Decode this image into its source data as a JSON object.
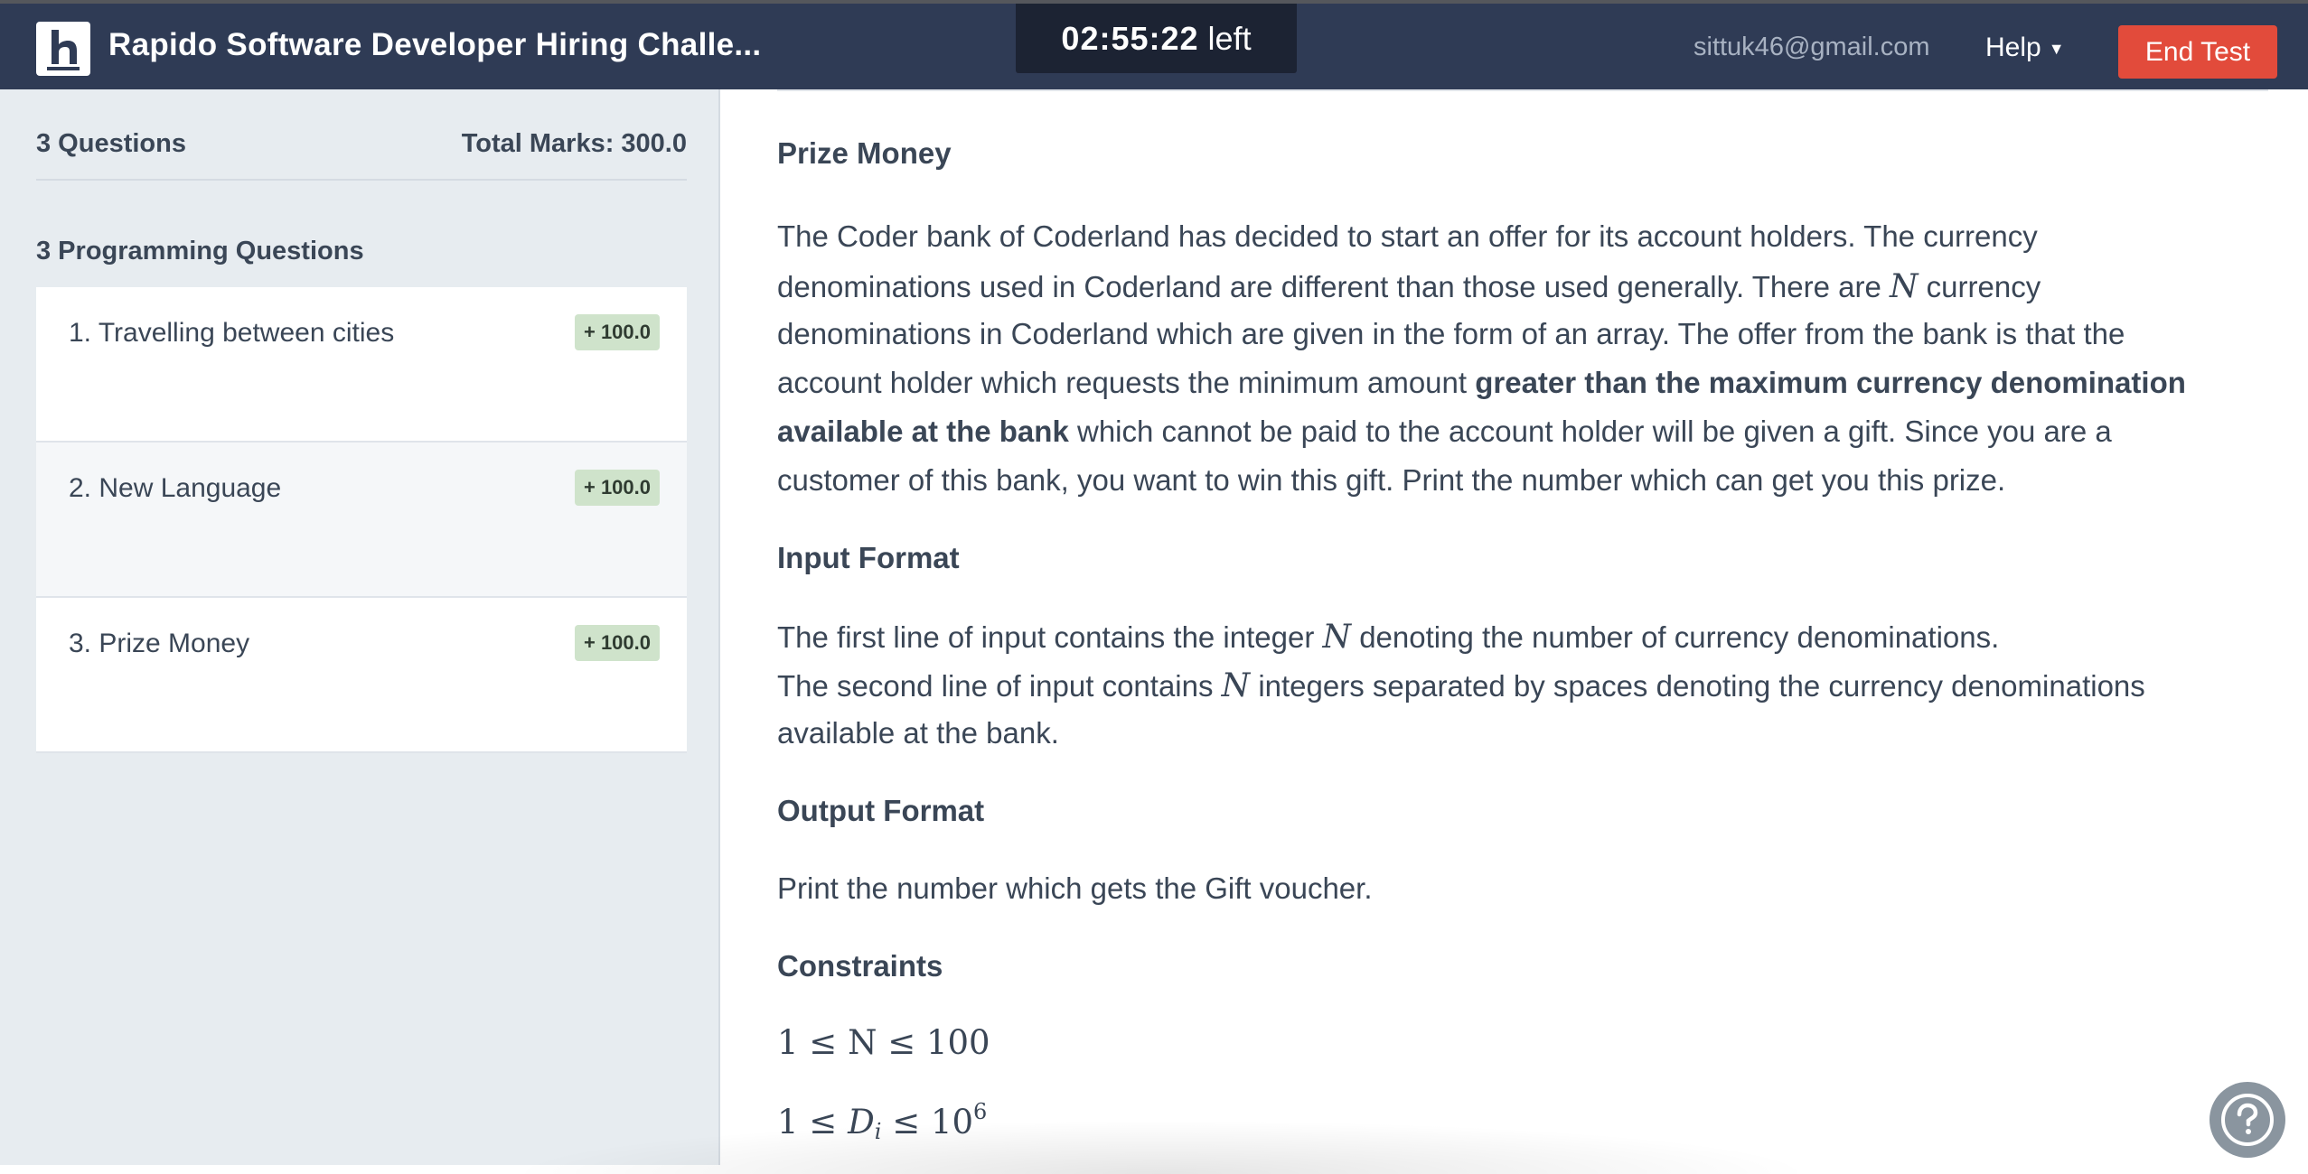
{
  "header": {
    "title": "Rapido Software Developer Hiring Challe...",
    "timer_value": "02:55:22",
    "timer_suffix": "left",
    "user_email": "sittuk46@gmail.com",
    "help_label": "Help",
    "end_test_label": "End Test"
  },
  "sidebar": {
    "questions_count": "3 Questions",
    "total_marks": "Total Marks: 300.0",
    "section_title": "3 Programming Questions",
    "questions": [
      {
        "label": "1. Travelling between cities",
        "marks": "+ 100.0"
      },
      {
        "label": "2. New Language",
        "marks": "+ 100.0"
      },
      {
        "label": "3. Prize Money",
        "marks": "+ 100.0"
      }
    ]
  },
  "problem": {
    "title": "Prize Money",
    "description": {
      "l1": "The Coder bank of Coderland has decided to start an offer for its account holders. The currency",
      "l2a": "denominations used in Coderland are different than those used generally. There are",
      "l2var": "N",
      "l2b": "currency",
      "l3": "denominations in Coderland which are given in the form of an array. The offer from the bank is that the",
      "l4a": "account holder which requests the minimum amount",
      "l4b": "greater than the maximum currency denomination",
      "l5a": "available at the bank",
      "l5b": "which cannot be paid to the account holder will be given a gift. Since you are a",
      "l6": "customer of this bank, you want to win this gift. Print the number which can get you this prize."
    },
    "input_format_heading": "Input Format",
    "input_format": {
      "l1a": "The first line of input contains the integer",
      "l1var": "N",
      "l1b": "denoting the number of currency denominations.",
      "l2a": "The second line of input contains",
      "l2var": "N",
      "l2b": "integers separated by spaces denoting the currency denominations",
      "l3": "available at the bank."
    },
    "output_format_heading": "Output Format",
    "output_format": "Print the number which gets the Gift voucher.",
    "constraints_heading": "Constraints",
    "constraints": {
      "c1": "1 ≤ N ≤ 100",
      "c2_left": "1 ≤ ",
      "c2_var": "D",
      "c2_sub": "i",
      "c2_right": " ≤ 10",
      "c2_sup": "6"
    }
  },
  "colors": {
    "header_bg": "#2f3b55",
    "timer_bg": "#1c2333",
    "end_test_bg": "#e24b3b",
    "sidebar_bg": "#e7ecf0",
    "marks_badge_bg": "#cfe3cb"
  }
}
